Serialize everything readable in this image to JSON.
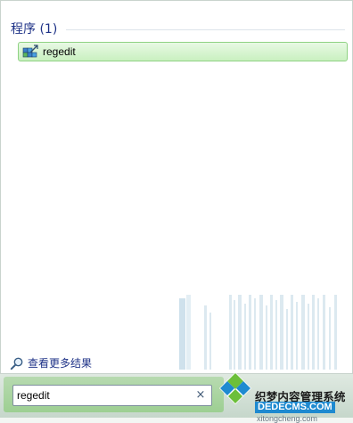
{
  "results": {
    "section_title": "程序 (1)",
    "items": [
      {
        "label": "regedit",
        "icon": "registry-editor-icon"
      }
    ],
    "see_more_label": "查看更多结果"
  },
  "search": {
    "value": "regedit",
    "clear_glyph": "×"
  },
  "watermark": {
    "title": "织梦内容管理系统",
    "domain": "DEDECMS.COM",
    "subdomain": "xitongcheng.com"
  },
  "colors": {
    "accent_text": "#1e3287",
    "highlight_border": "#8fd283",
    "highlight_fill": "#d4f4cd"
  }
}
